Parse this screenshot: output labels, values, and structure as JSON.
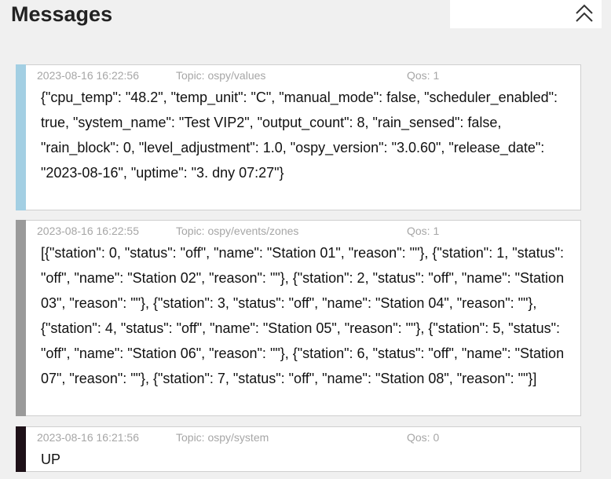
{
  "header": {
    "title": "Messages",
    "collapse_icon": "chevron-up-icon"
  },
  "messages": [
    {
      "timestamp": "2023-08-16 16:22:56",
      "topic": "Topic: ospy/values",
      "qos": "Qos: 1",
      "color": "#a3cfe3",
      "payload": "{\"cpu_temp\": \"48.2\", \"temp_unit\": \"C\", \"manual_mode\": false, \"scheduler_enabled\": true, \"system_name\": \"Test VIP2\", \"output_count\": 8, \"rain_sensed\": false, \"rain_block\": 0, \"level_adjustment\": 1.0, \"ospy_version\": \"3.0.60\", \"release_date\": \"2023-08-16\", \"uptime\": \"3. dny 07:27\"}"
    },
    {
      "timestamp": "2023-08-16 16:22:55",
      "topic": "Topic: ospy/events/zones",
      "qos": "Qos: 1",
      "color": "#9a9a9a",
      "payload": "[{\"station\": 0, \"status\": \"off\", \"name\": \"Station 01\", \"reason\": \"\"}, {\"station\": 1, \"status\": \"off\", \"name\": \"Station 02\", \"reason\": \"\"}, {\"station\": 2, \"status\": \"off\", \"name\": \"Station 03\", \"reason\": \"\"}, {\"station\": 3, \"status\": \"off\", \"name\": \"Station 04\", \"reason\": \"\"}, {\"station\": 4, \"status\": \"off\", \"name\": \"Station 05\", \"reason\": \"\"}, {\"station\": 5, \"status\": \"off\", \"name\": \"Station 06\", \"reason\": \"\"}, {\"station\": 6, \"status\": \"off\", \"name\": \"Station 07\", \"reason\": \"\"}, {\"station\": 7, \"status\": \"off\", \"name\": \"Station 08\", \"reason\": \"\"}]"
    },
    {
      "timestamp": "2023-08-16 16:21:56",
      "topic": "Topic: ospy/system",
      "qos": "Qos: 0",
      "color": "#1e1118",
      "payload": "UP"
    }
  ]
}
